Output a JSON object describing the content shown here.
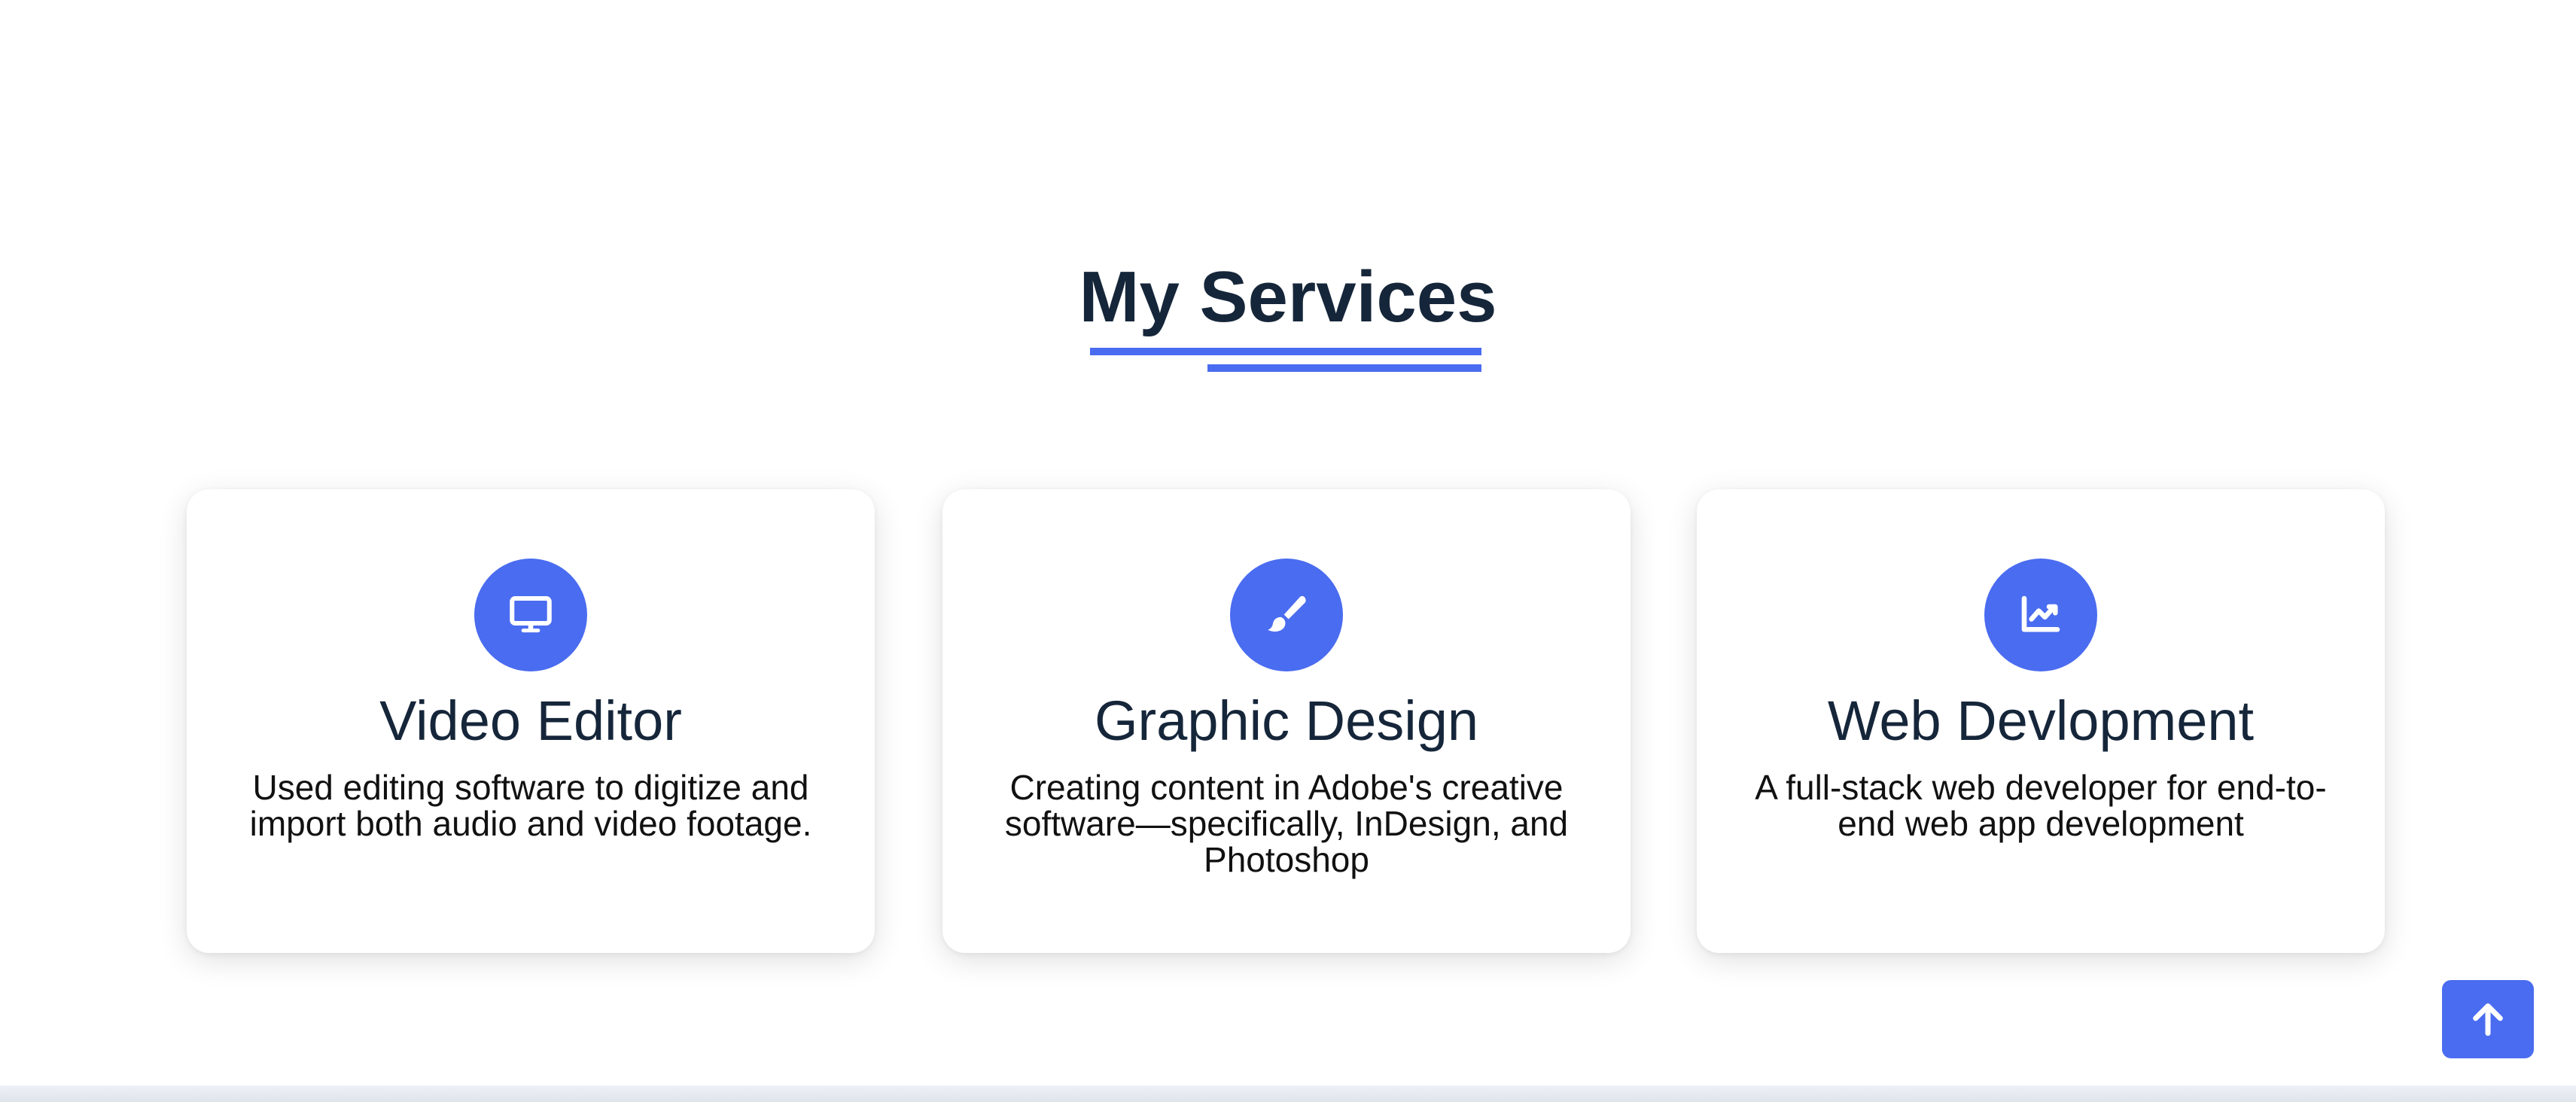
{
  "section": {
    "title": "My Services"
  },
  "services": [
    {
      "icon": "monitor-icon",
      "title": "Video Editor",
      "description": "Used editing software to digitize and import both audio and video footage."
    },
    {
      "icon": "paintbrush-icon",
      "title": "Graphic Design",
      "description": "Creating content in Adobe's creative software—specifically, InDesign, and Photoshop"
    },
    {
      "icon": "chart-line-icon",
      "title": "Web Devlopment",
      "description": "A full-stack web developer for end-to-end web app development"
    }
  ],
  "colors": {
    "accent": "#4a6cf0",
    "heading": "#16263a"
  },
  "scroll_top": {
    "icon": "arrow-up-icon"
  }
}
